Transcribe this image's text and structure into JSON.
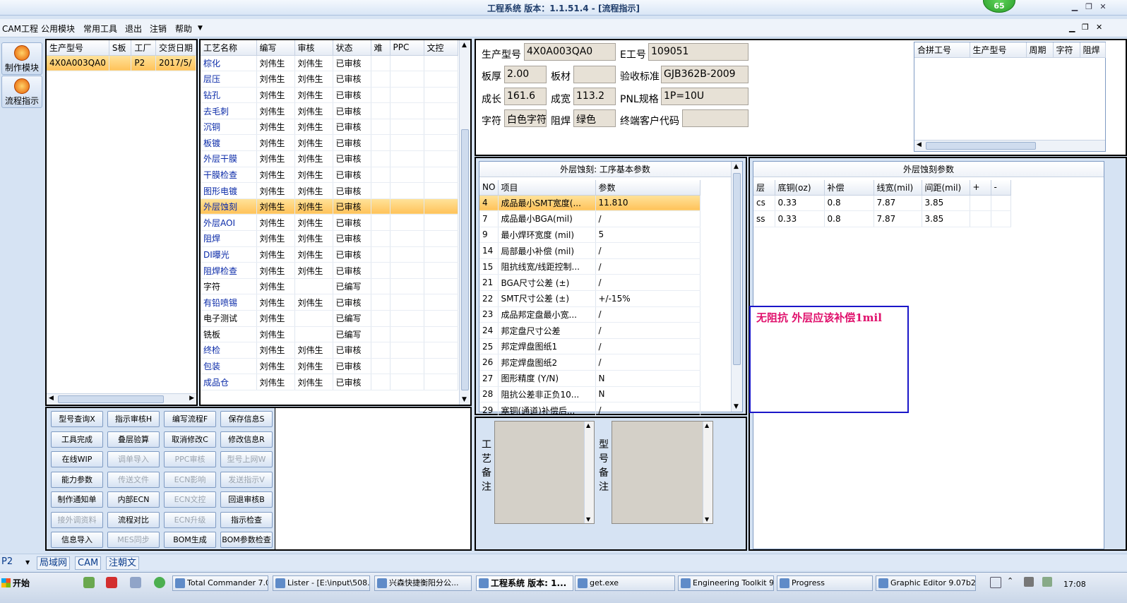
{
  "window": {
    "title": "工程系统  版本：1.1.51.4 - [流程指示]",
    "badge": "65"
  },
  "menu": {
    "items": [
      "CAM工程",
      "公用模块",
      "常用工具",
      "退出",
      "注销",
      "帮助"
    ]
  },
  "left_nav": [
    {
      "label": "制作模块",
      "icon": "fire-icon"
    },
    {
      "label": "流程指示",
      "icon": "flow-icon"
    }
  ],
  "orders": {
    "headers": [
      "生产型号",
      "S板",
      "工厂",
      "交货日期"
    ],
    "rows": [
      [
        "4X0A003QA0",
        "",
        "P2",
        "2017/5/"
      ]
    ]
  },
  "process": {
    "headers": [
      "工艺名称",
      "编写",
      "审核",
      "状态",
      "难",
      "PPC",
      "文控"
    ],
    "rows": [
      [
        "棕化",
        "刘伟生",
        "刘伟生",
        "已审核"
      ],
      [
        "层压",
        "刘伟生",
        "刘伟生",
        "已审核"
      ],
      [
        "钻孔",
        "刘伟生",
        "刘伟生",
        "已审核"
      ],
      [
        "去毛刺",
        "刘伟生",
        "刘伟生",
        "已审核"
      ],
      [
        "沉铜",
        "刘伟生",
        "刘伟生",
        "已审核"
      ],
      [
        "板镀",
        "刘伟生",
        "刘伟生",
        "已审核"
      ],
      [
        "外层干膜",
        "刘伟生",
        "刘伟生",
        "已审核"
      ],
      [
        "干膜检查",
        "刘伟生",
        "刘伟生",
        "已审核"
      ],
      [
        "图形电镀",
        "刘伟生",
        "刘伟生",
        "已审核"
      ],
      [
        "外层蚀刻",
        "刘伟生",
        "刘伟生",
        "已审核"
      ],
      [
        "外层AOI",
        "刘伟生",
        "刘伟生",
        "已审核"
      ],
      [
        "阻焊",
        "刘伟生",
        "刘伟生",
        "已审核"
      ],
      [
        "DI曝光",
        "刘伟生",
        "刘伟生",
        "已审核"
      ],
      [
        "阻焊检查",
        "刘伟生",
        "刘伟生",
        "已审核"
      ],
      [
        "字符",
        "刘伟生",
        "",
        "已编写"
      ],
      [
        "有铅喷锡",
        "刘伟生",
        "刘伟生",
        "已审核"
      ],
      [
        "电子测试",
        "刘伟生",
        "",
        "已编写"
      ],
      [
        "铣板",
        "刘伟生",
        "",
        "已编写"
      ],
      [
        "终检",
        "刘伟生",
        "刘伟生",
        "已审核"
      ],
      [
        "包装",
        "刘伟生",
        "刘伟生",
        "已审核"
      ],
      [
        "成品仓",
        "刘伟生",
        "刘伟生",
        "已审核"
      ]
    ],
    "selected_index": 9
  },
  "actions": [
    [
      "型号查询X",
      "指示审核H",
      "编写流程F",
      "保存信息S"
    ],
    [
      "工具完成",
      "叠层验算",
      "取消修改C",
      "修改信息R"
    ],
    [
      "在线WIP",
      "调单导入",
      "PPC审核",
      "型号上网W"
    ],
    [
      "能力参数",
      "传送文件",
      "ECN影响",
      "发送指示V"
    ],
    [
      "制作通知单",
      "内部ECN",
      "ECN文控",
      "回退审核B"
    ],
    [
      "接外调资料",
      "流程对比",
      "ECN升级",
      "指示检查"
    ],
    [
      "信息导入",
      "MES同步",
      "BOM生成",
      "BOM参数检查"
    ]
  ],
  "actions_disabled": [
    "调单导入",
    "PPC审核",
    "型号上网W",
    "传送文件",
    "ECN影响",
    "发送指示V",
    "ECN文控",
    "接外调资料",
    "ECN升级",
    "MES同步"
  ],
  "info": {
    "product_model_label": "生产型号",
    "product_model": "4X0A003QA0",
    "e_no_label": "E工号",
    "e_no": "109051",
    "thickness_label": "板厚",
    "thickness": "2.00",
    "material_label": "板材",
    "material": "",
    "standard_label": "验收标准",
    "standard": "GJB362B-2009",
    "length_label": "成长",
    "length": "161.6",
    "width_label": "成宽",
    "width": "113.2",
    "pnl_label": "PNL规格",
    "pnl": "1P=10U",
    "char_label": "字符",
    "char": "白色字符",
    "mask_label": "阻焊",
    "mask": "绿色",
    "customer_code_label": "终端客户代码",
    "customer_code": ""
  },
  "combine": {
    "headers": [
      "合拼工号",
      "生产型号",
      "周期",
      "字符",
      "阻焊"
    ]
  },
  "basic_params": {
    "title": "外层蚀刻: 工序基本参数",
    "headers": [
      "NO",
      "项目",
      "参数"
    ],
    "rows": [
      [
        "4",
        "成品最小SMT宽度(...",
        "11.810"
      ],
      [
        "7",
        "成品最小BGA(mil)",
        "/"
      ],
      [
        "9",
        "最小焊环宽度 (mil)",
        "5"
      ],
      [
        "14",
        "局部最小补偿 (mil)",
        "/"
      ],
      [
        "15",
        "阻抗线宽/线距控制...",
        "/"
      ],
      [
        "21",
        "BGA尺寸公差 (±)",
        "/"
      ],
      [
        "22",
        "SMT尺寸公差 (±)",
        "+/-15%"
      ],
      [
        "23",
        "成品邦定盘最小宽...",
        "/"
      ],
      [
        "24",
        "邦定盘尺寸公差",
        "/"
      ],
      [
        "25",
        "邦定焊盘图纸1",
        "/"
      ],
      [
        "26",
        "邦定焊盘图纸2",
        "/"
      ],
      [
        "27",
        "图形精度 (Y/N)",
        "N"
      ],
      [
        "28",
        "阻抗公差非正负10...",
        "N"
      ],
      [
        "29",
        "塞铜(通道)补偿后...",
        "/"
      ]
    ]
  },
  "etch_params": {
    "title": "外层蚀刻参数",
    "headers": [
      "层",
      "底铜(oz)",
      "补偿",
      "线宽(mil)",
      "间距(mil)",
      "+",
      "-"
    ],
    "rows": [
      [
        "cs",
        "0.33",
        "0.8",
        "7.87",
        "3.85",
        "",
        ""
      ],
      [
        "ss",
        "0.33",
        "0.8",
        "7.87",
        "3.85",
        "",
        ""
      ]
    ]
  },
  "note": {
    "text": "无阻抗   外层应该补偿1mil",
    "color": "#e0116c"
  },
  "memos": {
    "process_label": "工艺备注",
    "model_label": "型号备注"
  },
  "status": {
    "plant": "P2",
    "items": [
      "局域网",
      "CAM",
      "注朝文"
    ]
  },
  "taskbar": {
    "start": "开始",
    "tasks": [
      "Total Commander 7.0...",
      "Lister - [E:\\input\\508...",
      "兴森快捷衡阳分公...",
      "工程系统  版本: 1...",
      "get.exe",
      "Engineering Toolkit 9....",
      "Progress",
      "Graphic Editor 9.07b2..."
    ],
    "time": "17:08"
  }
}
